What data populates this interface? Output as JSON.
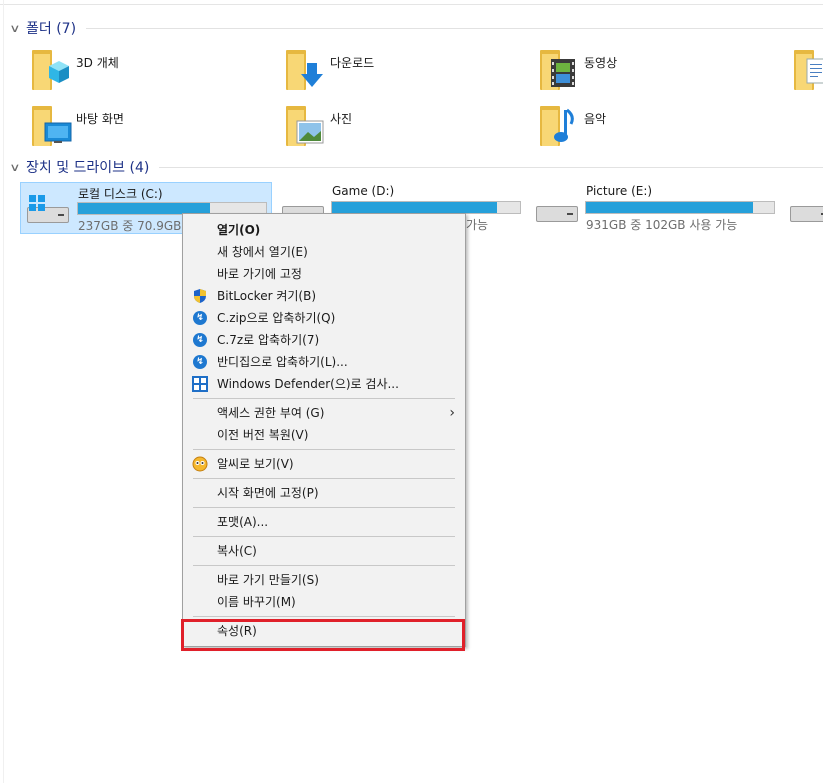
{
  "folders_group": {
    "title": "폴더 (7)"
  },
  "folders": [
    {
      "label": "3D 개체",
      "icon": "3d-objects-folder-icon"
    },
    {
      "label": "다운로드",
      "icon": "downloads-folder-icon"
    },
    {
      "label": "동영상",
      "icon": "videos-folder-icon"
    },
    {
      "label": "",
      "icon": "documents-folder-icon"
    },
    {
      "label": "바탕 화면",
      "icon": "desktop-folder-icon"
    },
    {
      "label": "사진",
      "icon": "pictures-folder-icon"
    },
    {
      "label": "음악",
      "icon": "music-folder-icon"
    }
  ],
  "drives_group": {
    "title": "장치 및 드라이브 (4)"
  },
  "drives": [
    {
      "name": "로컬 디스크 (C:)",
      "info": "237GB 중 70.9GB 사",
      "used_fraction": 0.7,
      "selected": true
    },
    {
      "name": "Game (D:)",
      "info": "가능",
      "used_fraction": 0.88,
      "selected": false
    },
    {
      "name": "Picture (E:)",
      "info": "931GB 중 102GB 사용 가능",
      "used_fraction": 0.89,
      "selected": false
    },
    {
      "name": "",
      "info": "",
      "used_fraction": 0,
      "selected": false
    }
  ],
  "context_menu": {
    "open": "열기(O)",
    "open_new_window": "새 창에서 열기(E)",
    "pin_quick_access": "바로 가기에 고정",
    "bitlocker": "BitLocker 켜기(B)",
    "zip": "C.zip으로 압축하기(Q)",
    "sevenz": "C.7z로 압축하기(7)",
    "bandizip": "반디집으로 압축하기(L)...",
    "defender": "Windows Defender(으)로 검사...",
    "give_access": "액세스 권한 부여 (G)",
    "restore_versions": "이전 버전 복원(V)",
    "alzip_view": "알씨로 보기(V)",
    "pin_start": "시작 화면에 고정(P)",
    "format": "포맷(A)...",
    "copy": "복사(C)",
    "create_shortcut": "바로 가기 만들기(S)",
    "rename": "이름 바꾸기(M)",
    "properties": "속성(R)"
  },
  "colors": {
    "accent": "#26a0da",
    "highlight_box": "#e0202a",
    "selection": "#cde8ff",
    "group_title": "#1e3287"
  }
}
